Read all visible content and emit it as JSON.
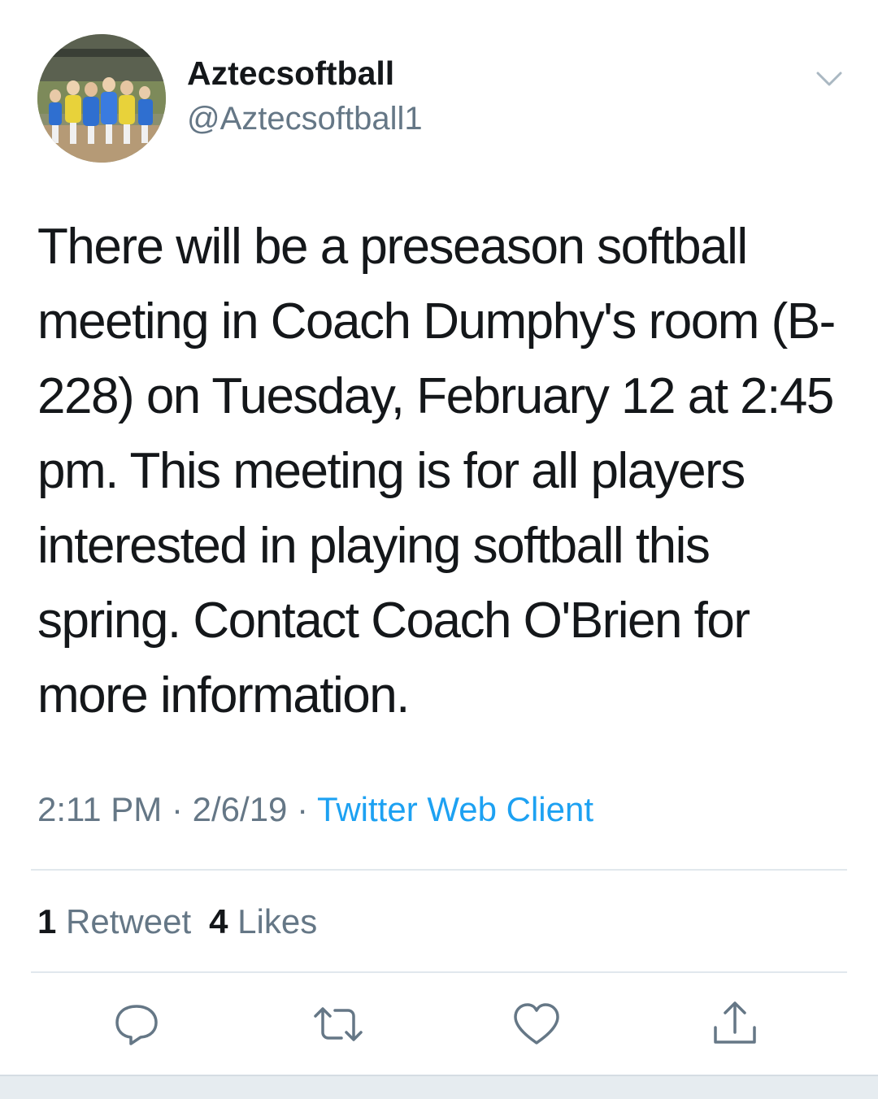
{
  "tweet": {
    "author": {
      "display_name": "Aztecsoftball",
      "handle": "@Aztecsoftball1",
      "avatar_icon": "team-photo-avatar"
    },
    "menu_icon": "chevron-down-icon",
    "text": "There will be a preseason softball meeting in Coach Dumphy's room (B-228) on Tuesday, February 12 at 2:45 pm. This meeting is for all players interested in playing softball this spring.  Contact Coach O'Brien for more information.",
    "time": "2:11 PM",
    "separator": "·",
    "date": "2/6/19",
    "source": "Twitter Web Client",
    "stats": {
      "retweet_count": "1",
      "retweet_label": "Retweet",
      "like_count": "4",
      "like_label": "Likes"
    },
    "actions": [
      {
        "name": "reply",
        "icon": "reply-icon"
      },
      {
        "name": "retweet",
        "icon": "retweet-icon"
      },
      {
        "name": "like",
        "icon": "heart-icon"
      },
      {
        "name": "share",
        "icon": "share-icon"
      }
    ],
    "colors": {
      "text": "#14171a",
      "secondary": "#657786",
      "link": "#1da1f2",
      "divider": "#e1e8ed"
    }
  }
}
